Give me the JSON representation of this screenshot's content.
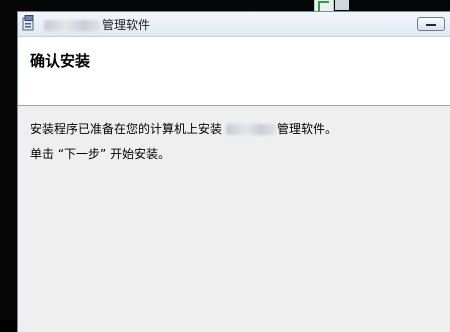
{
  "window": {
    "title_suffix": "管理软件",
    "title_redacted": "[blurred]"
  },
  "header": {
    "title": "确认安装"
  },
  "content": {
    "line1_prefix": "安装程序已准备在您的计算机上安装",
    "line1_redacted": "[blurred]",
    "line1_suffix": "管理软件。",
    "line2": "单击 “下一步” 开始安装。"
  },
  "icons": {
    "app_icon": "installer-icon",
    "minimize": "minimize-icon",
    "background_file": "spreadsheet-file-icon",
    "accent_green": "#2f9a4a"
  }
}
